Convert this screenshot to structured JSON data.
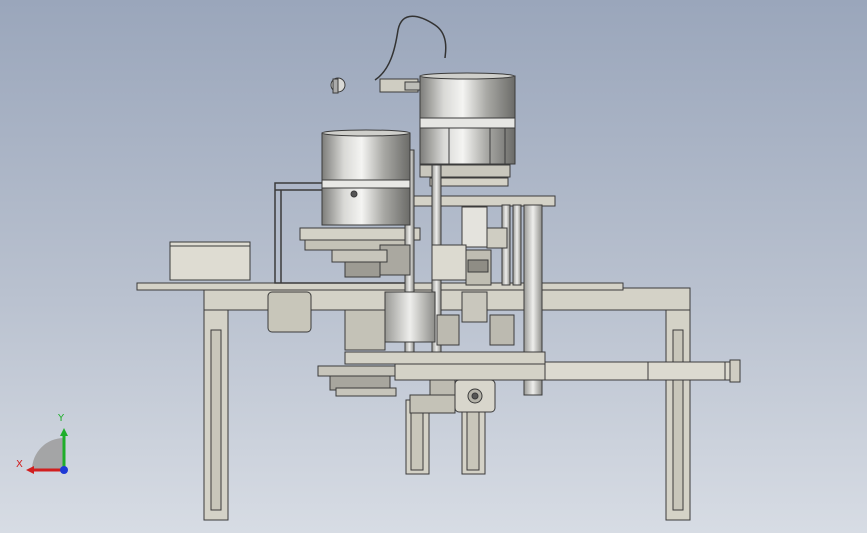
{
  "viewport": {
    "background_top": "#9aa6bb",
    "background_bottom": "#d7dce4"
  },
  "model": {
    "frame_color": "#d4d2c7",
    "edge_color": "#3b3b3b",
    "drum_light": "#f2f2f0",
    "drum_dark": "#6f6f6c"
  },
  "triad": {
    "x_label": "X",
    "y_label": "Y",
    "x_color": "#d11f1f",
    "y_color": "#1fae2a",
    "z_color": "#1e3ad6"
  }
}
